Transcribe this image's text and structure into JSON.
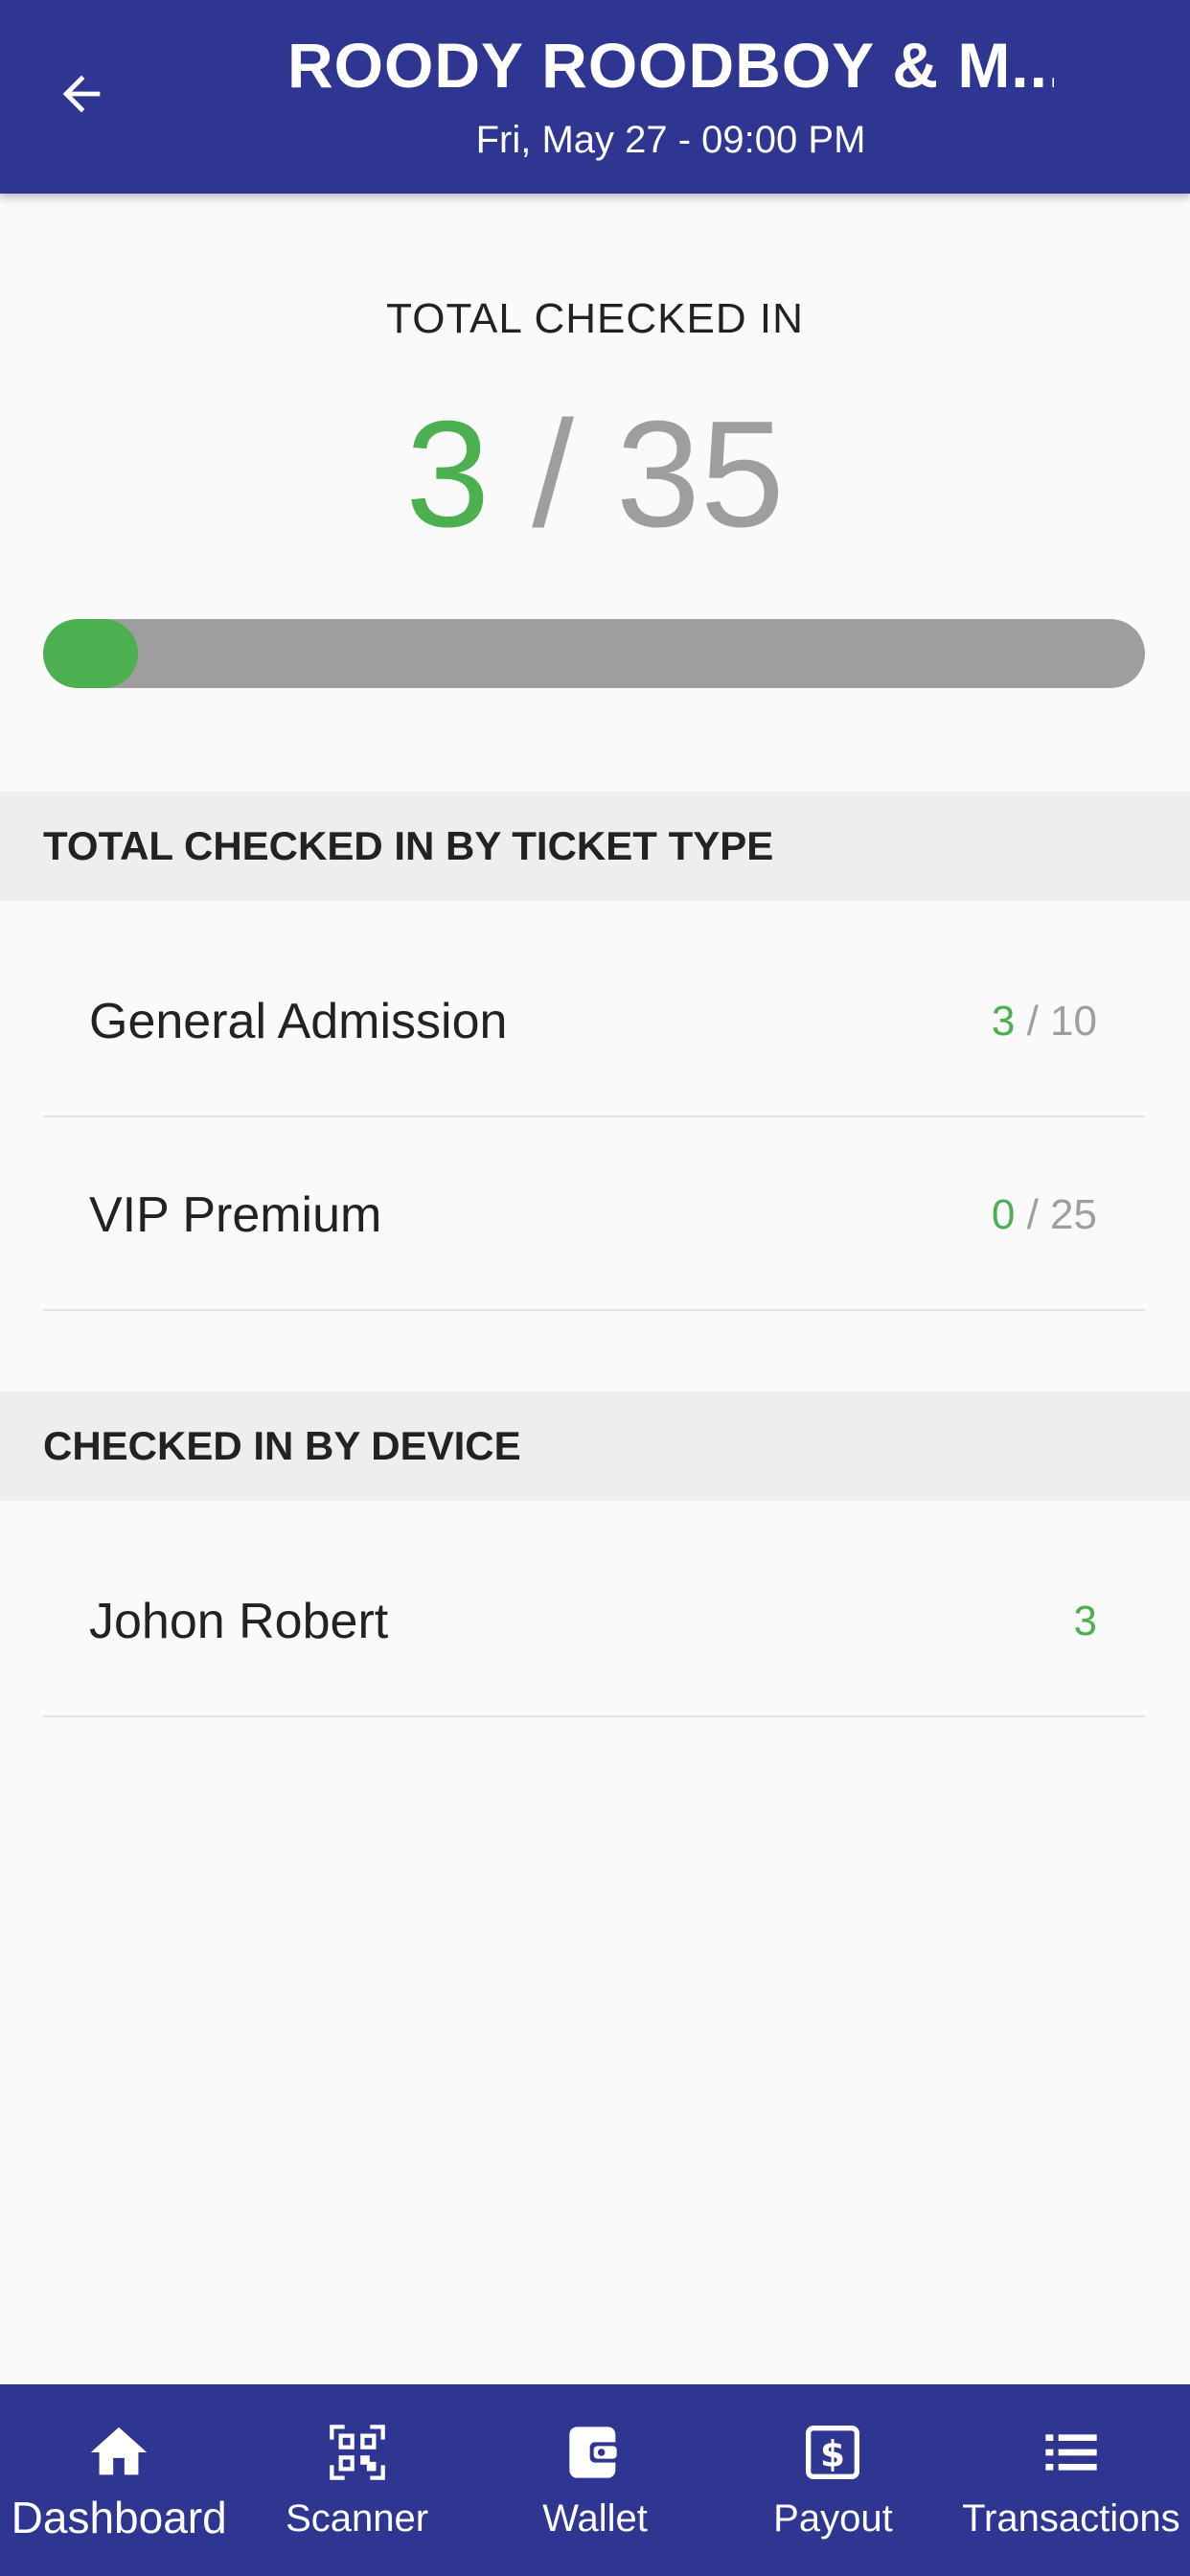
{
  "header": {
    "title": "ROODY ROODBOY &  M...",
    "subtitle": "Fri, May 27 - 09:00 PM",
    "back_icon": "arrow-left-icon"
  },
  "summary": {
    "label": "TOTAL CHECKED IN",
    "checked": "3",
    "separator": " / ",
    "total": "35",
    "progress_fraction": 0.0857,
    "accent_color": "#4caf50",
    "track_color": "#9e9e9e"
  },
  "ticket_types": {
    "header": "TOTAL CHECKED IN BY TICKET TYPE",
    "items": [
      {
        "label": "General Admission",
        "checked": "3",
        "separator": " / ",
        "total": "10"
      },
      {
        "label": "VIP Premium",
        "checked": "0",
        "separator": " / ",
        "total": "25"
      }
    ]
  },
  "devices": {
    "header": "CHECKED IN BY DEVICE",
    "items": [
      {
        "label": "Johon Robert",
        "count": "3"
      }
    ]
  },
  "bottom_nav": {
    "background": "#2e3691",
    "items": [
      {
        "label": "Dashboard",
        "icon": "home-icon",
        "active": true
      },
      {
        "label": "Scanner",
        "icon": "qr-code-icon",
        "active": false
      },
      {
        "label": "Wallet",
        "icon": "wallet-icon",
        "active": false
      },
      {
        "label": "Payout",
        "icon": "dollar-bill-icon",
        "active": false
      },
      {
        "label": "Transactions",
        "icon": "list-icon",
        "active": false
      }
    ]
  }
}
